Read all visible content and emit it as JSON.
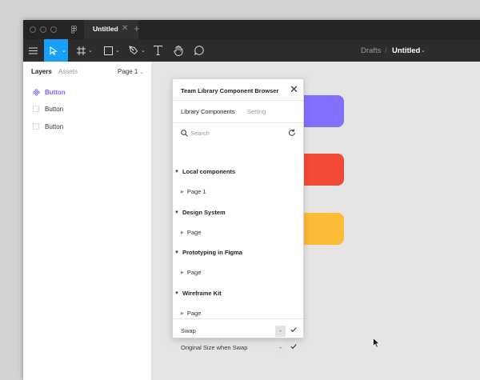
{
  "tabbar": {
    "doc_tab_title": "Untitled",
    "close_glyph": "✕",
    "new_tab_glyph": "+"
  },
  "toolbar": {
    "breadcrumb_drafts": "Drafts",
    "breadcrumb_sep": "/",
    "breadcrumb_title": "Untitled",
    "active_color": "#18a0fb"
  },
  "left_panel": {
    "tab_layers": "Layers",
    "tab_assets": "Assets",
    "page_select": "Page 1",
    "layers": [
      {
        "label": "Button",
        "icon": "component-icon",
        "selected": true
      },
      {
        "label": "Button",
        "icon": "frame-icon",
        "selected": false
      },
      {
        "label": "Button",
        "icon": "frame-icon",
        "selected": false
      }
    ],
    "selected_color": "#7b61ff"
  },
  "canvas": {
    "swatch_colors": [
      "#8470ff",
      "#f24a37",
      "#fdbc37"
    ]
  },
  "plugin": {
    "title": "Team Library Component Browser",
    "close_glyph": "✕",
    "tab_library": "Library Components",
    "tab_setting": "Setting",
    "search_placeholder": "Search",
    "groups": [
      {
        "name": "Local components",
        "page": "Page 1"
      },
      {
        "name": "Design System",
        "page": "Page"
      },
      {
        "name": "Prototyping in Figma",
        "page": "Page"
      },
      {
        "name": "Wireframe Kit",
        "page": "Page"
      }
    ],
    "options": [
      {
        "label": "Swap",
        "button": "-"
      },
      {
        "label": "Original Size when Swap",
        "button": "-"
      }
    ]
  }
}
